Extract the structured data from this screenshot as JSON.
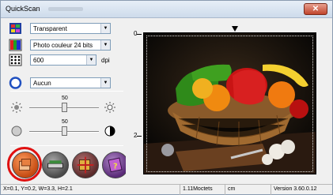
{
  "window": {
    "title": "QuickScan"
  },
  "controls": {
    "scan_source": {
      "value": "Transparent",
      "icon": "scanner-source-icon"
    },
    "scan_mode": {
      "value": "Photo couleur 24 bits",
      "icon": "color-mode-icon"
    },
    "resolution": {
      "value": "600",
      "unit": "dpi",
      "icon": "resolution-icon"
    },
    "filter": {
      "value": "Aucun",
      "icon": "filter-icon"
    }
  },
  "sliders": {
    "brightness": {
      "value": "50",
      "level": 50
    },
    "contrast": {
      "value": "50",
      "level": 50
    }
  },
  "toolbar": {
    "buttons": [
      "scan-button",
      "preview-button",
      "crop-button",
      "help-button"
    ]
  },
  "preview": {
    "ruler_labels": [
      "0",
      "2"
    ]
  },
  "status": {
    "coords": "X=0.1, Y=0.2, W=3.3, H=2.1",
    "size": "1.11Moctets",
    "units": "cm",
    "version": "Version 3.60.0.12"
  },
  "colors": {
    "highlight_ring": "#e01010",
    "preview_bg": "#000000"
  }
}
